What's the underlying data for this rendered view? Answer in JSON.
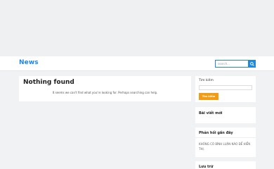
{
  "header": {
    "brand": "News",
    "search_placeholder": "search..."
  },
  "main": {
    "title": "Nothing found",
    "message": "It seems we can't find what you're looking for. Perhaps searching can help."
  },
  "sidebar": {
    "search_label": "Tìm kiếm",
    "search_button": "Tìm kiếm",
    "recent_posts_title": "Bài viết mới",
    "recent_comments_title": "Phản hồi gần đây",
    "recent_comments_empty": "KHÔNG CÓ BÌNH LUẬN NÀO ĐỂ HIỂN THỊ.",
    "archives_title": "Lưu trữ"
  },
  "colors": {
    "brand": "#1e88e5",
    "accent_button": "#f39c12"
  },
  "icons": {
    "search": "search-icon"
  }
}
